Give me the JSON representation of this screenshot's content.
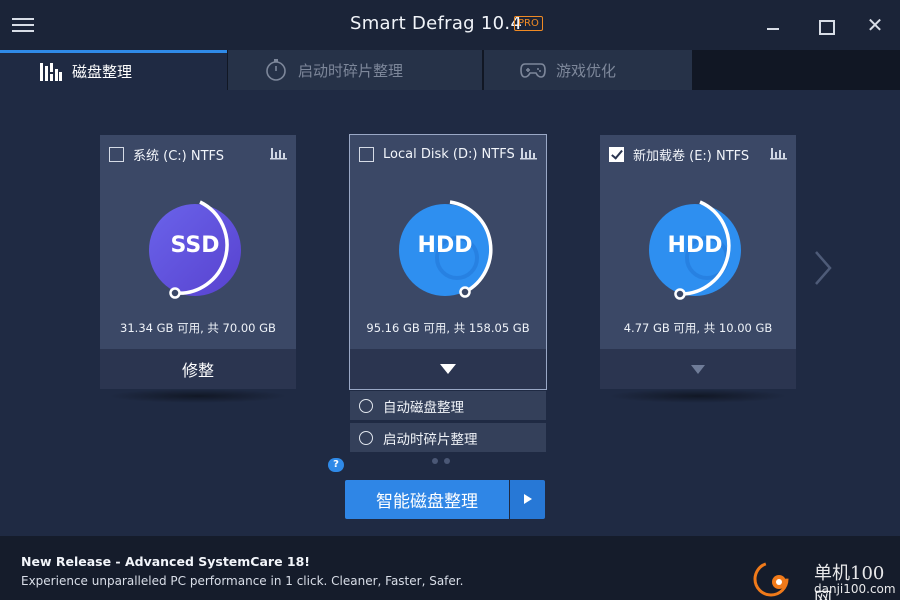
{
  "window": {
    "title": "Smart Defrag 10.4",
    "badge": "PRO",
    "close_glyph": "✕"
  },
  "tabs": [
    {
      "label": "磁盘整理",
      "icon": "defrag-bars-icon",
      "active": true
    },
    {
      "label": "启动时碎片整理",
      "icon": "timer-icon",
      "active": false
    },
    {
      "label": "游戏优化",
      "icon": "gamepad-icon",
      "active": false
    }
  ],
  "drives": [
    {
      "name": "系统 (C:) NTFS",
      "type": "SSD",
      "checked": false,
      "selected": false,
      "capacity": "31.34 GB 可用, 共 70.00 GB",
      "action": "修整",
      "color_a": "#5b5fe0",
      "color_b": "#6a4fd6"
    },
    {
      "name": "Local Disk (D:) NTFS",
      "type": "HDD",
      "checked": false,
      "selected": true,
      "capacity": "95.16 GB 可用, 共 158.05 GB",
      "action": "",
      "color_a": "#2e8ff0",
      "color_b": "#1f7be2"
    },
    {
      "name": "新加载卷 (E:) NTFS",
      "type": "HDD",
      "checked": true,
      "selected": false,
      "capacity": "4.77 GB 可用, 共 10.00 GB",
      "action": "",
      "color_a": "#2e8ff0",
      "color_b": "#1f7be2"
    }
  ],
  "options": [
    {
      "label": "自动磁盘整理"
    },
    {
      "label": "启动时碎片整理"
    }
  ],
  "help_label": "?",
  "main_button": {
    "label": "智能磁盘整理"
  },
  "footer": {
    "news_title": "New Release - Advanced SystemCare 18!",
    "news_desc": "Experience unparalleled PC performance in 1 click. Cleaner, Faster, Safer."
  },
  "watermark": {
    "line1": "单机100网",
    "line2": "danji100.com"
  },
  "colors": {
    "accent": "#2f86e6",
    "pro": "#f08a24",
    "background": "#1f2a43"
  }
}
